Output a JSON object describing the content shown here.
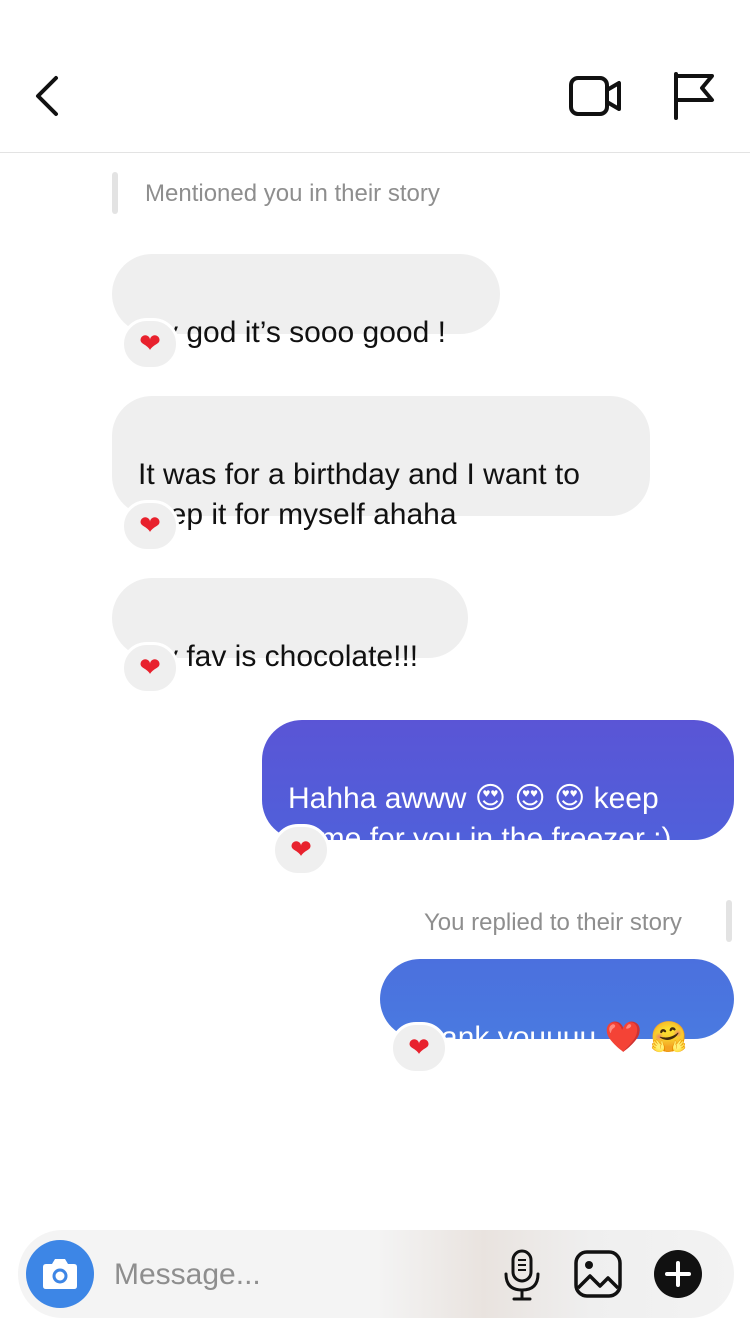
{
  "header": {
    "back_icon": "chevron-left-icon",
    "video_icon": "video-camera-icon",
    "flag_icon": "flag-icon"
  },
  "notices": {
    "mentioned": "Mentioned you in their story",
    "replied": "You replied to their story"
  },
  "messages": [
    {
      "direction": "incoming",
      "text": "My god it’s sooo good !",
      "reaction": "❤"
    },
    {
      "direction": "incoming",
      "text": "It was for a birthday and I want to\nkeep it for myself ahaha",
      "reaction": "❤"
    },
    {
      "direction": "incoming",
      "text": "My fav is chocolate!!!",
      "reaction": "❤"
    },
    {
      "direction": "outgoing",
      "text": "Hahha awww 😍 😍 😍  keep\nsome for you in the freezer ;)",
      "reaction": "❤"
    },
    {
      "direction": "outgoing",
      "text": "Thank youuuu ❤️ 🤗",
      "reaction": "❤"
    }
  ],
  "composer": {
    "placeholder": "Message...",
    "camera_icon": "camera-icon",
    "mic_icon": "microphone-icon",
    "gallery_icon": "image-gallery-icon",
    "plus_icon": "plus-icon"
  },
  "colors": {
    "outgoing_gradient_top": "#5a55d6",
    "outgoing_gradient_bottom": "#4a78df",
    "incoming_bubble": "#efefef",
    "camera_button": "#3d86e6",
    "heart": "#e8212d"
  }
}
